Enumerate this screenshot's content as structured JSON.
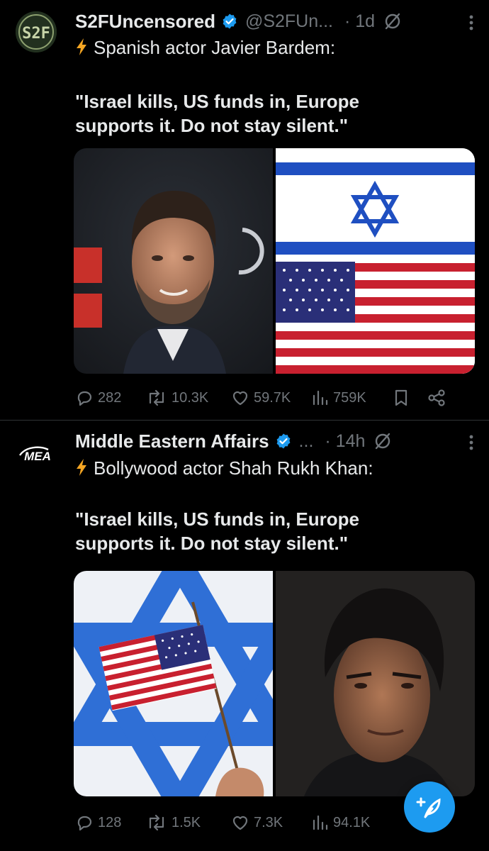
{
  "tweets": [
    {
      "author_name": "S2FUncensored",
      "handle": "@S2FUn...",
      "time": "· 1d",
      "avatar_text": "S2F",
      "text_line": "Spanish actor Javier Bardem:",
      "quote_line1": "\"Israel kills, US funds in, Europe",
      "quote_line2": "supports it. Do not stay silent.\"",
      "media": [
        "Javier Bardem photo",
        "Israeli flag above US flag"
      ],
      "stats": {
        "replies": "282",
        "reposts": "10.3K",
        "likes": "59.7K",
        "views": "759K"
      }
    },
    {
      "author_name": "Middle Eastern Affairs",
      "handle": "...",
      "time": "· 14h",
      "avatar_text": "MEA",
      "text_line": "Bollywood actor Shah Rukh Khan:",
      "quote_line1": "\"Israel kills, US funds in, Europe",
      "quote_line2": "supports it. Do not stay silent.\"",
      "media": [
        "US flag in front of Israeli flag",
        "Shah Rukh Khan photo"
      ],
      "stats": {
        "replies": "128",
        "reposts": "1.5K",
        "likes": "7.3K",
        "views": "94.1K"
      }
    }
  ],
  "colors": {
    "background": "#000000",
    "text": "#e7e9ea",
    "muted": "#71767b",
    "accent": "#1d9bf0",
    "verified": "#1d9bf0",
    "bolt": "#f5a623"
  },
  "icons": [
    "verified-badge-icon",
    "grok-icon",
    "more-icon",
    "lightning-icon",
    "reply-icon",
    "repost-icon",
    "like-icon",
    "views-icon",
    "bookmark-icon",
    "share-icon",
    "compose-icon"
  ]
}
